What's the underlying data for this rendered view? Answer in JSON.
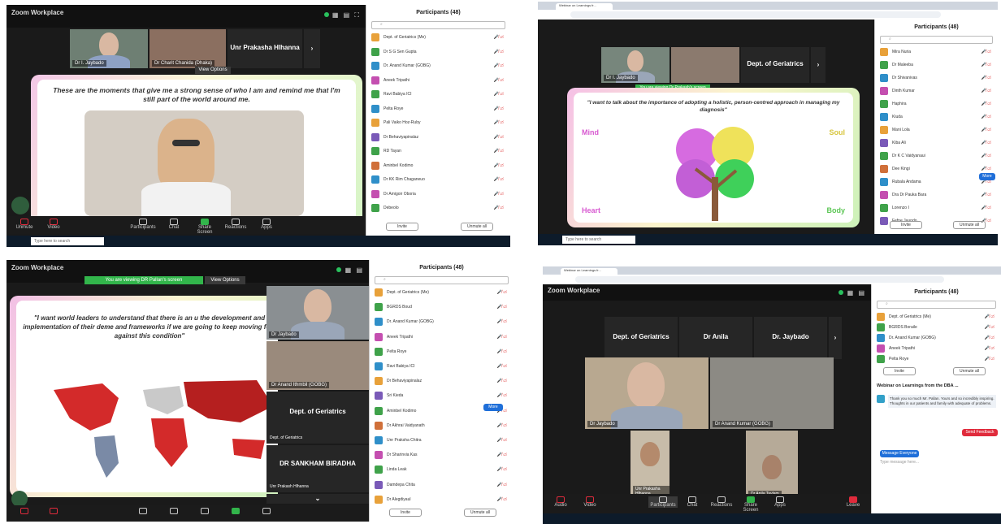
{
  "app": {
    "brand": "Zoom Workplace",
    "recording_label": "",
    "window_controls": "— □ ×"
  },
  "shot1": {
    "tiles": [
      "Dr I. Jaybado",
      "Dr Charit Chanida (Dhaka)",
      "Unr Prakasha Hlhanna"
    ],
    "view_options": "View Options",
    "quote": "These are the moments that give me a strong sense of who I am and remind me that I'm still part of the world around me.",
    "participants_title": "Participants (48)",
    "participants": [
      "Dept. of Geriatrics (Me)",
      "Dr S G Sen Gupta",
      "Dr. Anand Kumar (GOBG)",
      "Aneek Tripathi",
      "Ravi Babiya ICI",
      "Pelta Roye",
      "Pali Vaiko Hoz-Ruby",
      "Dr Behaviyapinalaz",
      "RD Tayan",
      "Aminbel Kodimo",
      "Dr KK Rim Chaganeuo",
      "Dr Amigoir Oboria",
      "Debeolo"
    ],
    "invite": "Invite",
    "unmute": "Unmute all",
    "toolbar": [
      "Unmute",
      "Video",
      "Participants",
      "Chat",
      "Share Screen",
      "Reactions",
      "Apps"
    ],
    "taskbar_search": "Type here to search"
  },
  "shot2": {
    "tab_title": "Webinar on Learnings fr...",
    "tiles": [
      "Dr I. Jaybado",
      "Dept. of Geriatrics"
    ],
    "banner": "You are viewing Dr Prakash's screen",
    "quote": "\"I want to talk about the importance of adopting a holistic, person-centred approach in managing my diagnosis\"",
    "labels": {
      "mind": "Mind",
      "soul": "Soul",
      "heart": "Heart",
      "body": "Body"
    },
    "participants_title": "Participants (48)",
    "participants": [
      "Mira Nuria",
      "Dr Maleeba",
      "Dr Shivanivas",
      "Dinth Kumar",
      "Haphira",
      "Kiuda",
      "Mani Lola",
      "Kiba Ali",
      "Dr K C Vaidyanaui",
      "Dee Kingi",
      "Rubala Andama",
      "Dra Dr Pauka Bara",
      "Lorenzo I",
      "Fefne Jaundo"
    ],
    "invite": "Invite",
    "unmute": "Unmute all",
    "more_btn": "More",
    "taskbar_search": "Type here to search"
  },
  "shot3": {
    "banner": "You are viewing DR Pallan's screen",
    "view_options": "View Options",
    "quote": "\"I want world leaders to understand that there is an u the development and implementation of their deme and frameworks if we are going to keep moving fore against this condition\"",
    "side_tiles": [
      "Dr Jaybado",
      "Dr Anand Ithmbil (GOBG)",
      "Dept. of Geriatrics",
      "DR SANKHAM BIRADHA"
    ],
    "side_captions": [
      "Dept. of Geriatrics",
      "Unr Prakash Hlhanna"
    ],
    "participants_title": "Participants (48)",
    "participants": [
      "Dept. of Geriatrics (Me)",
      "BGRDS Boud",
      "Dr. Anand Kumar (GOBG)",
      "Aneek Tripathi",
      "Pelta Roye",
      "Ravi Babiya ICI",
      "Dr Behaviyapinalaz",
      "Sri Kieda",
      "Aminbel Kodimo",
      "Dr Akhrai Vaidyanath",
      "Unr Praksha Chitra",
      "Dr Sharinvia Kas",
      "Linda Leak",
      "Damdepa Chita",
      "Dr Alegdiyaul"
    ],
    "more_btn": "More",
    "invite": "Invite",
    "unmute": "Unmute all"
  },
  "shot4": {
    "tab_title": "Webinar on Learnings fr...",
    "name_tiles": [
      "Dept. of Geriatrics",
      "Dr Anila",
      "Dr. Jaybado"
    ],
    "video_names": [
      "Dr Jaybado",
      "Dr Anand Kumar (GOBG)",
      "Unr Prakasha Hlhanna",
      "Dr Anila Taylam"
    ],
    "participants_title": "Participants (48)",
    "participants": [
      "Dept. of Geriatrics (Me)",
      "BGRDS Boraile",
      "Dr. Anand Kumar (GOBG)",
      "Aneek Tripathi",
      "Pelta Roye"
    ],
    "invite": "Invite",
    "unmute": "Unmute all",
    "chat_title": "Webinar on Learnings from the DBA ...",
    "chat_message": "Thank you so much Mr. Pallan. Yours and so incredibly inspiring. Thoughts in our patients and family with adequate of problems.",
    "chat_button": "Message Everyone",
    "chat_placeholder": "Type message here...",
    "send_label": "Send Feedback",
    "toolbar": [
      "Audio",
      "Video",
      "Participants",
      "Chat",
      "Reactions",
      "Share Screen",
      "Apps",
      "Leave"
    ]
  },
  "colors": {
    "zoom_green": "#32b54b",
    "zoom_blue": "#1f6fd9",
    "leave_red": "#e02b3c",
    "map_red": "#d32a2a"
  }
}
